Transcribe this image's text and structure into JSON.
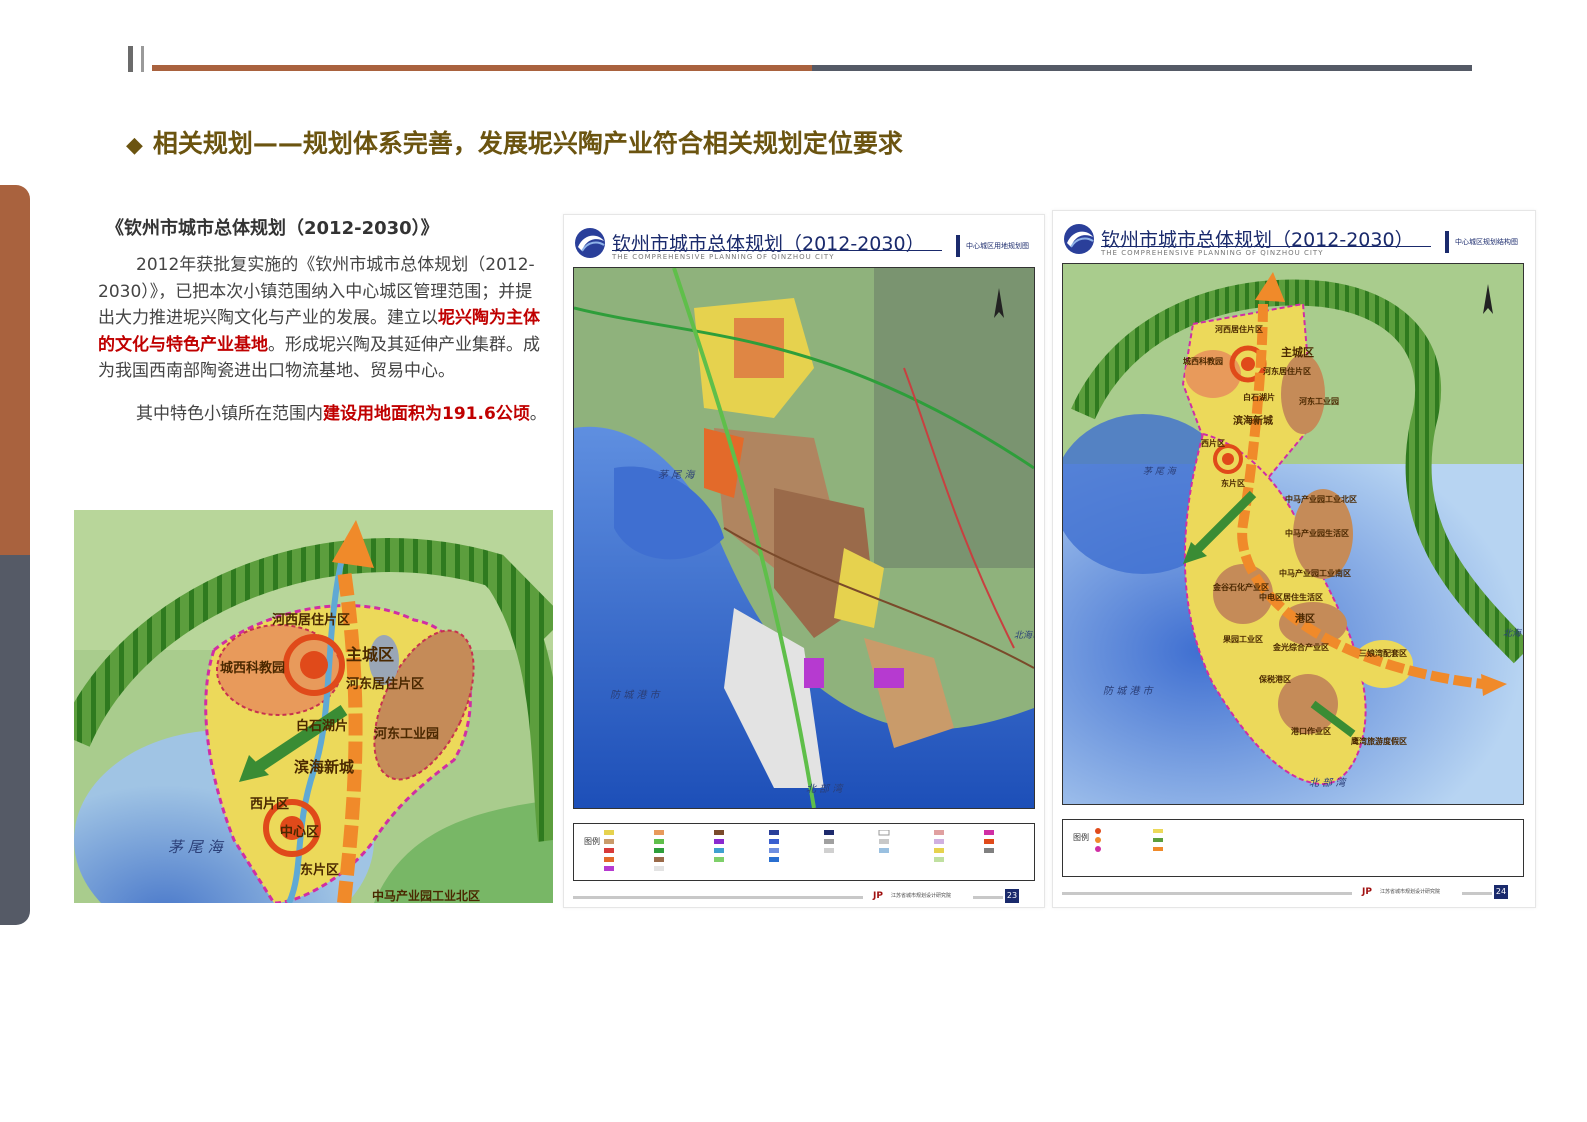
{
  "page_title": "相关规划——规划体系完善，发展坭兴陶产业符合相关规划定位要求",
  "title_bullet": "◆",
  "subtitle": "《钦州市城市总体规划（2012-2030）》",
  "paragraph1_before": "2012年获批复实施的《钦州市城市总体规划（2012-2030）》，已把本次小镇范围纳入中心城区管理范围；并提出大力推进坭兴陶文化与产业的发展。建立以",
  "paragraph1_highlight": "坭兴陶为主体的文化与特色产业基地",
  "paragraph1_after": "。形成坭兴陶及其延伸产业集群。成为我国西南部陶瓷进出口物流基地、贸易中心。",
  "paragraph2_before": "其中特色小镇所在范围内",
  "paragraph2_highlight": "建设用地面积为191.6公顷",
  "paragraph2_after": "。",
  "left_map_labels": {
    "hexi": "河西居住片区",
    "zhucheng": "主城区",
    "chengxi": "城西科教园",
    "hedong_res": "河东居住片区",
    "baishi": "白石湖片",
    "hedong_ind": "河东工业园",
    "binhai": "滨海新城",
    "xipian": "西片区",
    "zhongxin": "中心区",
    "dongpian": "东片区",
    "maowei": "茅 尾 海",
    "zhongma": "中马产业园工业北区"
  },
  "card1": {
    "title": "钦州市城市总体规划（2012-2030）",
    "subtitle": "THE COMPREHENSIVE PLANNING OF QINZHOU CITY",
    "tag": "中心城区用地规划图",
    "maowei": "茅 尾 海",
    "fangcheng": "防 城 港 市",
    "beibu": "北 部 湾",
    "beihai": "北海市",
    "legend_word": "图例",
    "institute": "江苏省城市规划设计研究院",
    "page": "23"
  },
  "card2": {
    "title": "钦州市城市总体规划（2012-2030）",
    "subtitle": "THE COMPREHENSIVE PLANNING OF QINZHOU CITY",
    "tag": "中心城区规划结构图",
    "hexi": "河西居住片区",
    "chengxi": "城西科教园",
    "zhucheng": "主城区",
    "hedong_res": "河东居住片区",
    "baishi": "白石湖片",
    "hedong_ind": "河东工业园",
    "binhai": "滨海新城",
    "xipian": "西片区",
    "dongpian": "东片区",
    "maowei": "茅 尾 海",
    "zhongma_n": "中马产业园工业北区",
    "zhongma_s": "中马产业园生活区",
    "zhongma_ind": "中马产业园工业南区",
    "jinggu": "金谷石化产业区",
    "zhongdian": "中电区居住生活区",
    "gangqu": "港区",
    "jinguang": "金光综合产业区",
    "guoyuan": "果园工业区",
    "baoshui": "保税港区",
    "sanniang": "三娘湾配套区",
    "yinwan": "鹰湾旅游度假区",
    "gangkou": "港口作业区",
    "fangcheng": "防 城 港 市",
    "beibu": "北 部 湾",
    "beihai": "北海",
    "legend_word": "图例",
    "institute": "江苏省城市规划设计研究院",
    "page": "24"
  },
  "colors": {
    "brown": "#a9623e",
    "slate": "#555a66",
    "title": "#6b5410",
    "highlight": "#c00000",
    "navy": "#1a2a6c"
  }
}
